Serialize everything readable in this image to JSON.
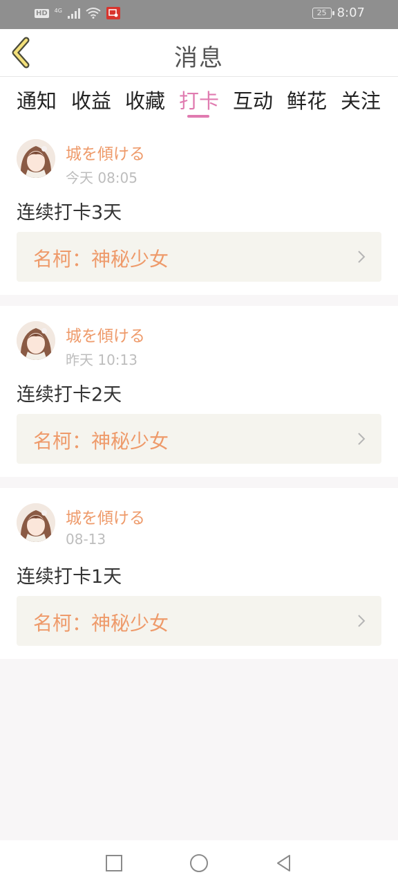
{
  "status_bar": {
    "hd_badge": "HD",
    "network": "4G",
    "battery": "25",
    "time": "8:07"
  },
  "header": {
    "title": "消息"
  },
  "tabs": [
    {
      "label": "通知"
    },
    {
      "label": "收益"
    },
    {
      "label": "收藏"
    },
    {
      "label": "打卡"
    },
    {
      "label": "互动"
    },
    {
      "label": "鲜花"
    },
    {
      "label": "关注"
    }
  ],
  "active_tab": "打卡",
  "messages": [
    {
      "user": "城を傾ける",
      "time": "今天 08:05",
      "text": "连续打卡3天",
      "link": "名柯：神秘少女"
    },
    {
      "user": "城を傾ける",
      "time": "昨天 10:13",
      "text": "连续打卡2天",
      "link": "名柯：神秘少女"
    },
    {
      "user": "城を傾ける",
      "time": "08-13",
      "text": "连续打卡1天",
      "link": "名柯：神秘少女"
    }
  ],
  "colors": {
    "accent_pink": "#e07bb0",
    "accent_orange": "#ee9a6a",
    "back_icon_yellow": "#f3e07a"
  },
  "icons": {
    "back": "chevron-left-icon",
    "nav_recent": "square-icon",
    "nav_home": "circle-icon",
    "nav_back": "triangle-back-icon"
  }
}
